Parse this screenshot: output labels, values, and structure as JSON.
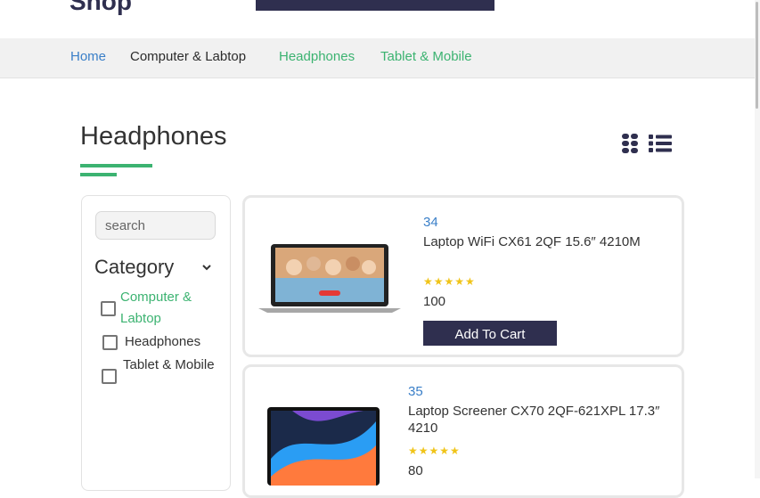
{
  "header": {
    "logo": "Shop"
  },
  "nav": {
    "items": [
      {
        "label": "Home",
        "color": "#3a7fc8"
      },
      {
        "label": "Computer & Labtop",
        "color": "#2b2b2b"
      },
      {
        "label": "Headphones",
        "color": "#3cb371"
      },
      {
        "label": "Tablet & Mobile",
        "color": "#3cb371"
      }
    ]
  },
  "page": {
    "title": "Headphones",
    "accent_color": "#3cb371"
  },
  "view_toggle": {
    "grid_icon": "grid-icon",
    "list_icon": "list-icon"
  },
  "sidebar": {
    "search": {
      "placeholder": "search",
      "value": ""
    },
    "category": {
      "heading": "Category",
      "items": [
        {
          "label": "Computer & Labtop",
          "checked": false
        },
        {
          "label": "Headphones",
          "checked": false
        },
        {
          "label": "Tablet & Mobile",
          "checked": false
        }
      ]
    }
  },
  "products": [
    {
      "id": "34",
      "name": "Laptop WiFi CX61 2QF 15.6″ 4210M",
      "stars": "★★★★★",
      "rating": 5,
      "price": "100",
      "add_to_cart": "Add To Cart"
    },
    {
      "id": "35",
      "name": "Laptop Screener CX70 2QF-621XPL 17.3″ 4210",
      "stars": "★★★★★",
      "rating": 5,
      "price": "80"
    }
  ],
  "colors": {
    "dark": "#2f2f4f",
    "link": "#3a7fc8",
    "star": "#f0c419"
  }
}
